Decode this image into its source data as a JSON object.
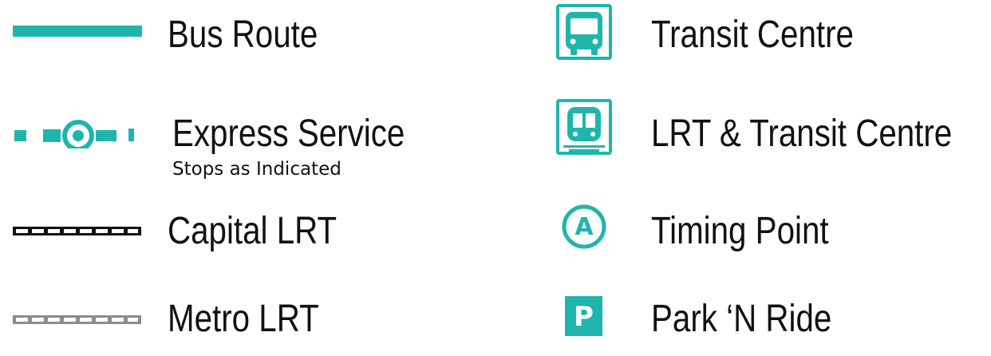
{
  "legend": {
    "accent_color": "#1fb5ad",
    "dark_color": "#111111",
    "light_color": "#ffffff",
    "gray_color": "#8c8c8c",
    "left": [
      {
        "id": "bus-route",
        "label": "Bus Route",
        "icon": "solid-route-line-icon"
      },
      {
        "id": "express-service",
        "label": "Express Service",
        "sublabel": "Stops as Indicated",
        "icon": "express-stop-icon"
      },
      {
        "id": "capital-lrt",
        "label": "Capital LRT",
        "icon": "capital-lrt-track-icon"
      },
      {
        "id": "metro-lrt",
        "label": "Metro LRT",
        "icon": "metro-lrt-track-icon"
      }
    ],
    "right": [
      {
        "id": "transit-centre",
        "label": "Transit Centre",
        "icon": "bus-transit-centre-icon"
      },
      {
        "id": "lrt-transit-centre",
        "label": "LRT & Transit Centre",
        "icon": "lrt-transit-centre-icon"
      },
      {
        "id": "timing-point",
        "label": "Timing Point",
        "icon": "timing-point-icon",
        "marker": "A"
      },
      {
        "id": "park-n-ride",
        "label": "Park ‘N Ride",
        "icon": "park-n-ride-icon",
        "marker": "P"
      }
    ]
  }
}
